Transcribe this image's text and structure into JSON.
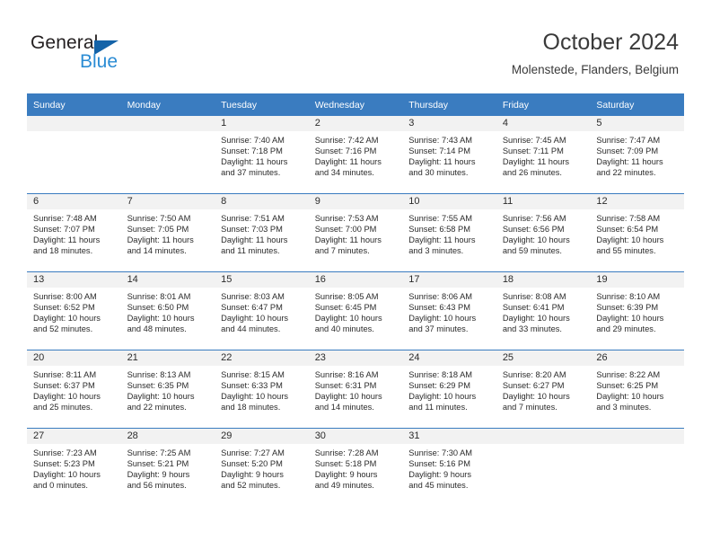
{
  "logo": {
    "primary_text": "General",
    "secondary_text": "Blue",
    "primary_color": "#231f20",
    "secondary_color": "#2b8cd4",
    "triangle_color": "#1463a8",
    "icon": "triangle-icon"
  },
  "header": {
    "title": "October 2024",
    "subtitle": "Molenstede, Flanders, Belgium"
  },
  "theme": {
    "header_bg": "#3a7cc0",
    "header_text": "#ffffff",
    "daynum_band_bg": "#f2f2f2",
    "row_divider": "#3a7cc0",
    "body_text": "#2b2b2b"
  },
  "weekdays": [
    "Sunday",
    "Monday",
    "Tuesday",
    "Wednesday",
    "Thursday",
    "Friday",
    "Saturday"
  ],
  "weeks": [
    [
      {
        "day": "",
        "sunrise": "",
        "sunset": "",
        "daylight_line1": "",
        "daylight_line2": "",
        "empty": true
      },
      {
        "day": "",
        "sunrise": "",
        "sunset": "",
        "daylight_line1": "",
        "daylight_line2": "",
        "empty": true
      },
      {
        "day": "1",
        "sunrise": "Sunrise: 7:40 AM",
        "sunset": "Sunset: 7:18 PM",
        "daylight_line1": "Daylight: 11 hours",
        "daylight_line2": "and 37 minutes."
      },
      {
        "day": "2",
        "sunrise": "Sunrise: 7:42 AM",
        "sunset": "Sunset: 7:16 PM",
        "daylight_line1": "Daylight: 11 hours",
        "daylight_line2": "and 34 minutes."
      },
      {
        "day": "3",
        "sunrise": "Sunrise: 7:43 AM",
        "sunset": "Sunset: 7:14 PM",
        "daylight_line1": "Daylight: 11 hours",
        "daylight_line2": "and 30 minutes."
      },
      {
        "day": "4",
        "sunrise": "Sunrise: 7:45 AM",
        "sunset": "Sunset: 7:11 PM",
        "daylight_line1": "Daylight: 11 hours",
        "daylight_line2": "and 26 minutes."
      },
      {
        "day": "5",
        "sunrise": "Sunrise: 7:47 AM",
        "sunset": "Sunset: 7:09 PM",
        "daylight_line1": "Daylight: 11 hours",
        "daylight_line2": "and 22 minutes."
      }
    ],
    [
      {
        "day": "6",
        "sunrise": "Sunrise: 7:48 AM",
        "sunset": "Sunset: 7:07 PM",
        "daylight_line1": "Daylight: 11 hours",
        "daylight_line2": "and 18 minutes."
      },
      {
        "day": "7",
        "sunrise": "Sunrise: 7:50 AM",
        "sunset": "Sunset: 7:05 PM",
        "daylight_line1": "Daylight: 11 hours",
        "daylight_line2": "and 14 minutes."
      },
      {
        "day": "8",
        "sunrise": "Sunrise: 7:51 AM",
        "sunset": "Sunset: 7:03 PM",
        "daylight_line1": "Daylight: 11 hours",
        "daylight_line2": "and 11 minutes."
      },
      {
        "day": "9",
        "sunrise": "Sunrise: 7:53 AM",
        "sunset": "Sunset: 7:00 PM",
        "daylight_line1": "Daylight: 11 hours",
        "daylight_line2": "and 7 minutes."
      },
      {
        "day": "10",
        "sunrise": "Sunrise: 7:55 AM",
        "sunset": "Sunset: 6:58 PM",
        "daylight_line1": "Daylight: 11 hours",
        "daylight_line2": "and 3 minutes."
      },
      {
        "day": "11",
        "sunrise": "Sunrise: 7:56 AM",
        "sunset": "Sunset: 6:56 PM",
        "daylight_line1": "Daylight: 10 hours",
        "daylight_line2": "and 59 minutes."
      },
      {
        "day": "12",
        "sunrise": "Sunrise: 7:58 AM",
        "sunset": "Sunset: 6:54 PM",
        "daylight_line1": "Daylight: 10 hours",
        "daylight_line2": "and 55 minutes."
      }
    ],
    [
      {
        "day": "13",
        "sunrise": "Sunrise: 8:00 AM",
        "sunset": "Sunset: 6:52 PM",
        "daylight_line1": "Daylight: 10 hours",
        "daylight_line2": "and 52 minutes."
      },
      {
        "day": "14",
        "sunrise": "Sunrise: 8:01 AM",
        "sunset": "Sunset: 6:50 PM",
        "daylight_line1": "Daylight: 10 hours",
        "daylight_line2": "and 48 minutes."
      },
      {
        "day": "15",
        "sunrise": "Sunrise: 8:03 AM",
        "sunset": "Sunset: 6:47 PM",
        "daylight_line1": "Daylight: 10 hours",
        "daylight_line2": "and 44 minutes."
      },
      {
        "day": "16",
        "sunrise": "Sunrise: 8:05 AM",
        "sunset": "Sunset: 6:45 PM",
        "daylight_line1": "Daylight: 10 hours",
        "daylight_line2": "and 40 minutes."
      },
      {
        "day": "17",
        "sunrise": "Sunrise: 8:06 AM",
        "sunset": "Sunset: 6:43 PM",
        "daylight_line1": "Daylight: 10 hours",
        "daylight_line2": "and 37 minutes."
      },
      {
        "day": "18",
        "sunrise": "Sunrise: 8:08 AM",
        "sunset": "Sunset: 6:41 PM",
        "daylight_line1": "Daylight: 10 hours",
        "daylight_line2": "and 33 minutes."
      },
      {
        "day": "19",
        "sunrise": "Sunrise: 8:10 AM",
        "sunset": "Sunset: 6:39 PM",
        "daylight_line1": "Daylight: 10 hours",
        "daylight_line2": "and 29 minutes."
      }
    ],
    [
      {
        "day": "20",
        "sunrise": "Sunrise: 8:11 AM",
        "sunset": "Sunset: 6:37 PM",
        "daylight_line1": "Daylight: 10 hours",
        "daylight_line2": "and 25 minutes."
      },
      {
        "day": "21",
        "sunrise": "Sunrise: 8:13 AM",
        "sunset": "Sunset: 6:35 PM",
        "daylight_line1": "Daylight: 10 hours",
        "daylight_line2": "and 22 minutes."
      },
      {
        "day": "22",
        "sunrise": "Sunrise: 8:15 AM",
        "sunset": "Sunset: 6:33 PM",
        "daylight_line1": "Daylight: 10 hours",
        "daylight_line2": "and 18 minutes."
      },
      {
        "day": "23",
        "sunrise": "Sunrise: 8:16 AM",
        "sunset": "Sunset: 6:31 PM",
        "daylight_line1": "Daylight: 10 hours",
        "daylight_line2": "and 14 minutes."
      },
      {
        "day": "24",
        "sunrise": "Sunrise: 8:18 AM",
        "sunset": "Sunset: 6:29 PM",
        "daylight_line1": "Daylight: 10 hours",
        "daylight_line2": "and 11 minutes."
      },
      {
        "day": "25",
        "sunrise": "Sunrise: 8:20 AM",
        "sunset": "Sunset: 6:27 PM",
        "daylight_line1": "Daylight: 10 hours",
        "daylight_line2": "and 7 minutes."
      },
      {
        "day": "26",
        "sunrise": "Sunrise: 8:22 AM",
        "sunset": "Sunset: 6:25 PM",
        "daylight_line1": "Daylight: 10 hours",
        "daylight_line2": "and 3 minutes."
      }
    ],
    [
      {
        "day": "27",
        "sunrise": "Sunrise: 7:23 AM",
        "sunset": "Sunset: 5:23 PM",
        "daylight_line1": "Daylight: 10 hours",
        "daylight_line2": "and 0 minutes."
      },
      {
        "day": "28",
        "sunrise": "Sunrise: 7:25 AM",
        "sunset": "Sunset: 5:21 PM",
        "daylight_line1": "Daylight: 9 hours",
        "daylight_line2": "and 56 minutes."
      },
      {
        "day": "29",
        "sunrise": "Sunrise: 7:27 AM",
        "sunset": "Sunset: 5:20 PM",
        "daylight_line1": "Daylight: 9 hours",
        "daylight_line2": "and 52 minutes."
      },
      {
        "day": "30",
        "sunrise": "Sunrise: 7:28 AM",
        "sunset": "Sunset: 5:18 PM",
        "daylight_line1": "Daylight: 9 hours",
        "daylight_line2": "and 49 minutes."
      },
      {
        "day": "31",
        "sunrise": "Sunrise: 7:30 AM",
        "sunset": "Sunset: 5:16 PM",
        "daylight_line1": "Daylight: 9 hours",
        "daylight_line2": "and 45 minutes."
      },
      {
        "day": "",
        "sunrise": "",
        "sunset": "",
        "daylight_line1": "",
        "daylight_line2": "",
        "empty": true
      },
      {
        "day": "",
        "sunrise": "",
        "sunset": "",
        "daylight_line1": "",
        "daylight_line2": "",
        "empty": true
      }
    ]
  ]
}
